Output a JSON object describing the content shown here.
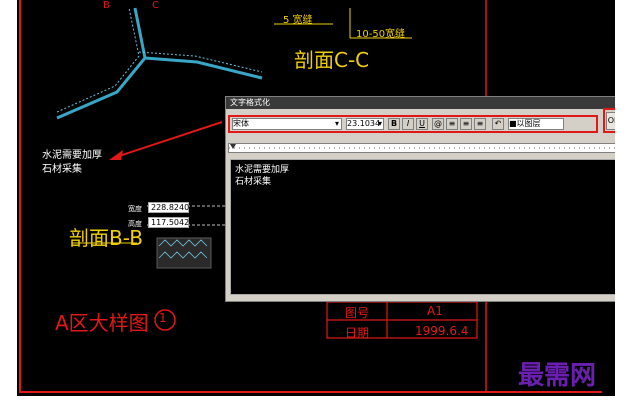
{
  "cad": {
    "weld_label_1": "5 宽缝",
    "weld_label_2": "10-50宽缝",
    "section_cc": "剖面C-C",
    "section_bb": "剖面B-B",
    "marker_b": "B",
    "marker_c": "C",
    "note_line1": "水泥需要加厚",
    "note_line2": "石材采集",
    "width_label": "宽度",
    "width_value": "228.8240",
    "height_label": "高度",
    "height_value": "117.5042",
    "zone_title": "A区大样图",
    "zone_number": "1",
    "drawing_no_label": "图号",
    "drawing_no_value": "A1",
    "date_label": "日期",
    "date_value": "1999.6.4"
  },
  "dialog": {
    "title": "文字格式化",
    "close_glyph": "×",
    "font_name": "宋体",
    "font_size": "23.1034",
    "bold": "B",
    "italic": "I",
    "underline": "U",
    "at_symbol": "@",
    "stack_label": "■以图层",
    "ok_label": "OK",
    "editor_line1": "水泥需要加厚",
    "editor_line2": "石材采集"
  },
  "watermark": "最需网"
}
